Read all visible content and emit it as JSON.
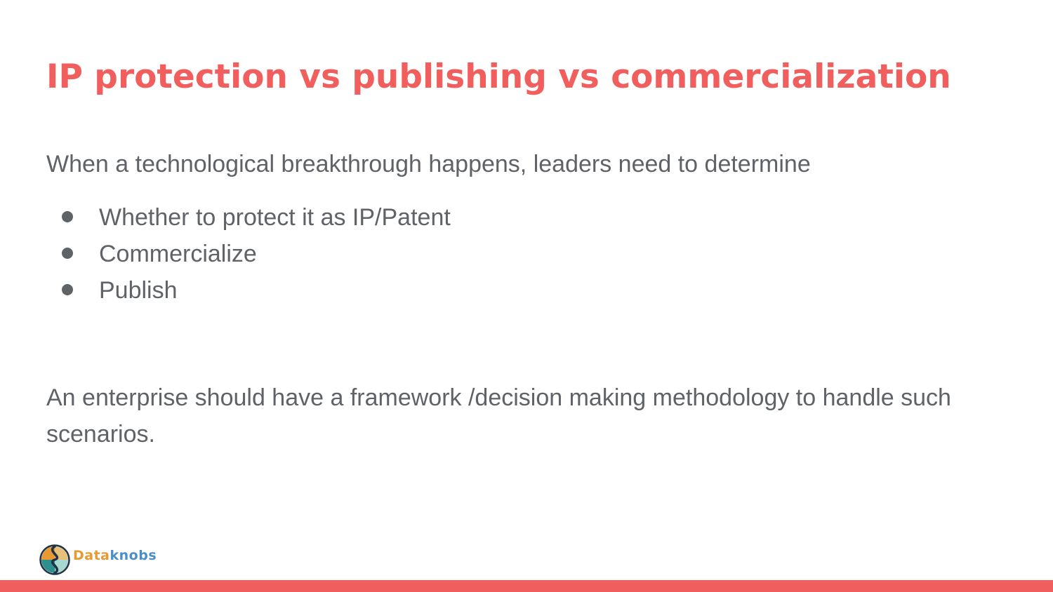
{
  "slide": {
    "title": "IP protection vs publishing vs commercialization",
    "intro": "When a technological breakthrough happens, leaders need to determine",
    "bullets": [
      "Whether to protect it as IP/Patent",
      "Commercialize",
      "Publish"
    ],
    "closing": "An enterprise should have a framework /decision making methodology to handle such scenarios."
  },
  "logo": {
    "text_part1": "Data",
    "text_part2": "knobs",
    "icon": "dataknobs-logo-icon"
  },
  "colors": {
    "accent": "#f15e5e",
    "body_text": "#5f6368",
    "logo_orange": "#e79a34",
    "logo_blue": "#4a8fc7",
    "background": "#ffffff"
  }
}
